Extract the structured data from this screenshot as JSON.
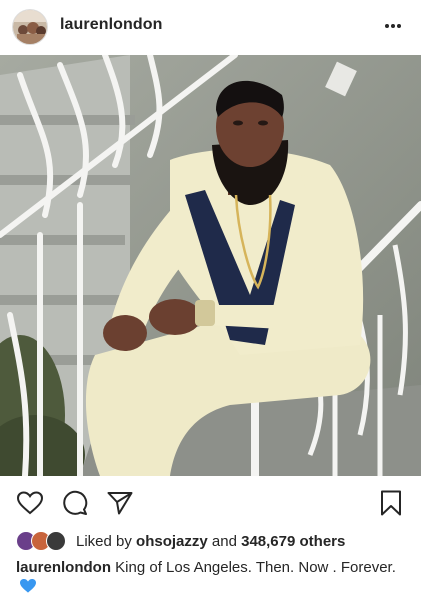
{
  "post": {
    "username": "laurenlondon",
    "more_label": "more options"
  },
  "photo": {
    "alt_semantic": "man-seated-on-stairs-photo"
  },
  "actions": {
    "like_icon": "heart-icon",
    "comment_icon": "comment-icon",
    "share_icon": "send-icon",
    "save_icon": "bookmark-icon"
  },
  "likes": {
    "prefix": "Liked by",
    "first_user": "ohsojazzy",
    "connector": "and",
    "count": "348,679 others"
  },
  "caption": {
    "user": "laurenlondon",
    "text": "King of Los Angeles. Then. Now . Forever.",
    "emoji": "blue-heart-icon",
    "emoji_color": "#3897f0"
  }
}
